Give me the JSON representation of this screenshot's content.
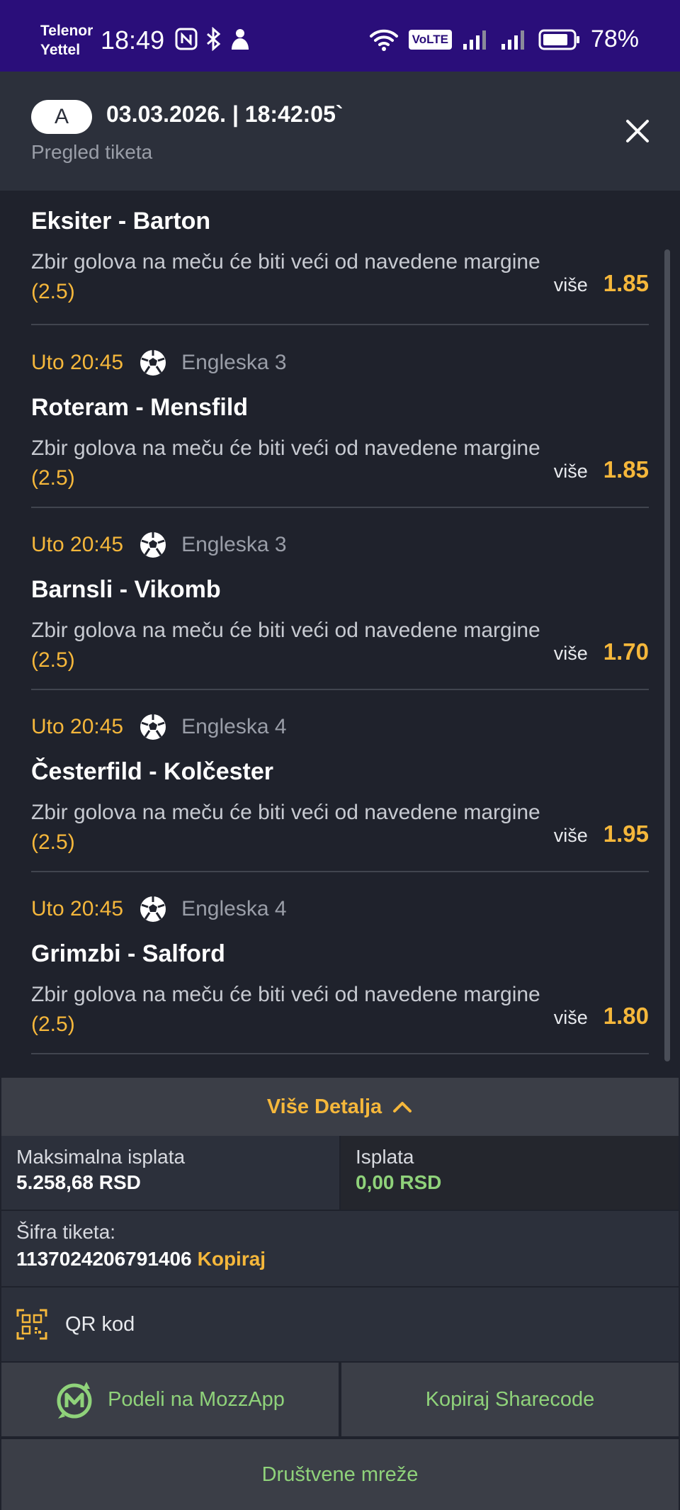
{
  "status_bar": {
    "carrier_line1": "Telenor",
    "carrier_line2": "Yettel",
    "time": "18:49",
    "volte": "VoLTE",
    "battery": "78%"
  },
  "header": {
    "avatar": "A",
    "datetime": "03.03.2026. | 18:42:05`",
    "subtitle": "Pregled tiketa"
  },
  "matches": [
    {
      "time": "",
      "league": "",
      "teams": "Eksiter - Barton",
      "desc": "Zbir golova na meču će biti veći od navedene margine",
      "margin": "(2.5)",
      "pick": "više",
      "odd": "1.85"
    },
    {
      "time": "Uto 20:45",
      "league": "Engleska 3",
      "teams": "Roteram - Mensfild",
      "desc": "Zbir golova na meču će biti veći od navedene margine",
      "margin": "(2.5)",
      "pick": "više",
      "odd": "1.85"
    },
    {
      "time": "Uto 20:45",
      "league": "Engleska 3",
      "teams": "Barnsli - Vikomb",
      "desc": "Zbir golova na meču će biti veći od navedene margine",
      "margin": "(2.5)",
      "pick": "više",
      "odd": "1.70"
    },
    {
      "time": "Uto 20:45",
      "league": "Engleska 4",
      "teams": "Česterfild - Kolčester",
      "desc": "Zbir golova na meču će biti veći od navedene margine",
      "margin": "(2.5)",
      "pick": "više",
      "odd": "1.95"
    },
    {
      "time": "Uto 20:45",
      "league": "Engleska 4",
      "teams": "Grimzbi - Salford",
      "desc": "Zbir golova na meču će biti veći od navedene margine",
      "margin": "(2.5)",
      "pick": "više",
      "odd": "1.80"
    }
  ],
  "details": {
    "toggle_label": "Više Detalja",
    "max_payout_label": "Maksimalna isplata",
    "max_payout_value": "5.258,68 RSD",
    "payout_label": "Isplata",
    "payout_value": "0,00 RSD",
    "ticket_code_label": "Šifra tiketa:",
    "ticket_code": "1137024206791406",
    "copy_label": "Kopiraj",
    "qr_label": "QR kod",
    "share_mozz": "Podeli na MozzApp",
    "copy_sharecode": "Kopiraj Sharecode",
    "social": "Društvene mreže"
  },
  "colors": {
    "accent": "#f5b73b",
    "green": "#8fd27a",
    "status_bar": "#2a0e7a",
    "background": "#1f222c"
  }
}
